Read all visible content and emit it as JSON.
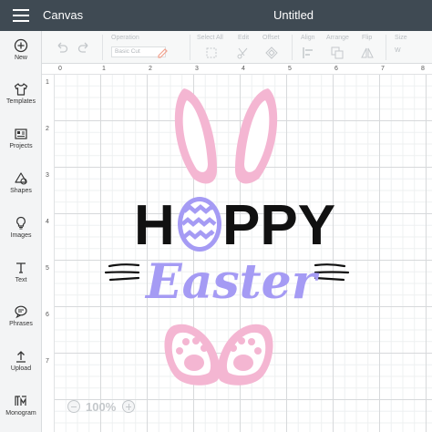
{
  "topbar": {
    "app_title": "Canvas",
    "doc_title": "Untitled"
  },
  "sidebar": {
    "items": [
      {
        "label": "New",
        "icon": "plus-circle-icon"
      },
      {
        "label": "Templates",
        "icon": "shirt-icon"
      },
      {
        "label": "Projects",
        "icon": "projects-icon"
      },
      {
        "label": "Shapes",
        "icon": "shapes-icon"
      },
      {
        "label": "Images",
        "icon": "bulb-icon"
      },
      {
        "label": "Text",
        "icon": "text-icon"
      },
      {
        "label": "Phrases",
        "icon": "speech-bubble-icon"
      },
      {
        "label": "Upload",
        "icon": "upload-icon"
      },
      {
        "label": "Monogram",
        "icon": "monogram-icon"
      }
    ]
  },
  "toolbar": {
    "operation_label": "Operation",
    "operation_value": "Basic Cut",
    "select_all_label": "Select All",
    "edit_label": "Edit",
    "offset_label": "Offset",
    "align_label": "Align",
    "arrange_label": "Arrange",
    "flip_label": "Flip",
    "size_label": "Size",
    "size_w": "W"
  },
  "ruler": {
    "top": [
      "0",
      "1",
      "2",
      "3",
      "4",
      "5",
      "6",
      "7",
      "8"
    ],
    "left": [
      "1",
      "2",
      "3",
      "4",
      "5",
      "6",
      "7"
    ]
  },
  "design": {
    "word1": "H",
    "word1b": "PPY",
    "word2": "Easter",
    "colors": {
      "ears": "#f4b6d2",
      "black": "#111111",
      "purple": "#a59bf4",
      "paws": "#f4b6d2"
    }
  },
  "zoom": {
    "value": "100%"
  }
}
